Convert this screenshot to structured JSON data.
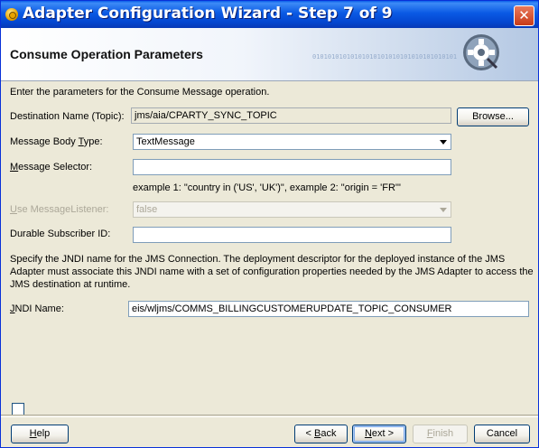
{
  "window": {
    "title": "Adapter Configuration Wizard - Step 7 of 9",
    "close_glyph": "✕"
  },
  "header": {
    "title": "Consume Operation Parameters",
    "decoration_binary": "0101010101010101010101010101010101010101010101010101"
  },
  "intro": "Enter the parameters for the Consume Message operation.",
  "fields": {
    "destination": {
      "label": "Destination Name (Topic):",
      "value": "jms/aia/CPARTY_SYNC_TOPIC",
      "button": "Browse..."
    },
    "message_body_type": {
      "label_pre": "Message Body ",
      "label_u": "T",
      "label_post": "ype:",
      "value": "TextMessage"
    },
    "message_selector": {
      "label_u": "M",
      "label_post": "essage Selector:",
      "value": "",
      "example": "example 1: \"country in ('US', 'UK')\", example 2: \"origin = 'FR'\""
    },
    "use_listener": {
      "label_u": "U",
      "label_post": "se MessageListener:",
      "value": "false"
    },
    "durable_id": {
      "label": "Durable Subscriber ID:",
      "value": ""
    }
  },
  "jndi": {
    "description": "Specify the JNDI name for the JMS Connection.  The deployment descriptor for the deployed instance of the JMS Adapter must associate this JNDI name with a set of configuration properties needed by the JMS Adapter to access the JMS destination at runtime.",
    "label_u": "J",
    "label_post": "NDI Name:",
    "value": "eis/wljms/COMMS_BILLINGCUSTOMERUPDATE_TOPIC_CONSUMER"
  },
  "buttons": {
    "help": {
      "u": "H",
      "rest": "elp"
    },
    "back": {
      "pre": "< ",
      "u": "B",
      "rest": "ack"
    },
    "next": {
      "u": "N",
      "rest": "ext >"
    },
    "finish": {
      "u": "F",
      "rest": "inish"
    },
    "cancel": "Cancel"
  }
}
